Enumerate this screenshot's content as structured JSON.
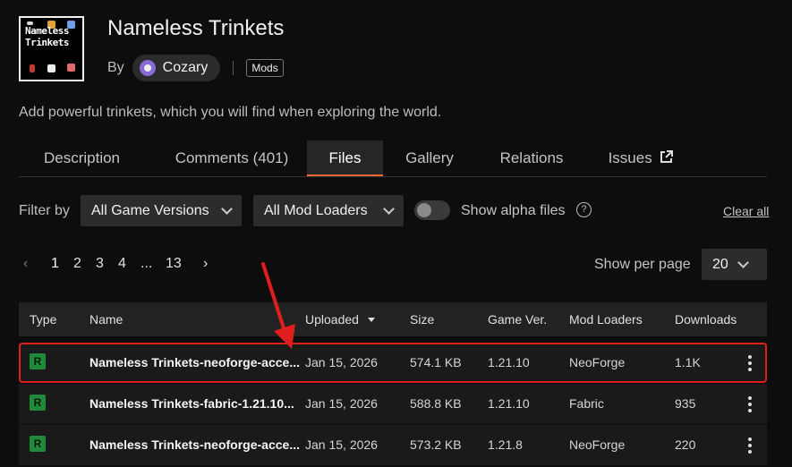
{
  "project": {
    "title": "Nameless Trinkets",
    "by_label": "By",
    "author": "Cozary",
    "category": "Mods",
    "summary": "Add powerful trinkets, which you will find when exploring the world.",
    "logo_text_line1": "Nameless",
    "logo_text_line2": "Trinkets"
  },
  "tabs": [
    {
      "label": "Description"
    },
    {
      "label": "Comments (401)"
    },
    {
      "label": "Files"
    },
    {
      "label": "Gallery"
    },
    {
      "label": "Relations"
    },
    {
      "label": "Issues"
    }
  ],
  "filters": {
    "label": "Filter by",
    "game_versions": "All Game Versions",
    "mod_loaders": "All Mod Loaders",
    "alpha_label": "Show alpha files",
    "help": "?",
    "clear": "Clear all"
  },
  "pagination": {
    "prev": "‹",
    "pages": [
      "1",
      "2",
      "3",
      "4"
    ],
    "ellipsis": "...",
    "last": "13",
    "next": "›",
    "per_page_label": "Show per page",
    "per_page_value": "20"
  },
  "table": {
    "headers": {
      "type": "Type",
      "name": "Name",
      "uploaded": "Uploaded",
      "size": "Size",
      "game_ver": "Game Ver.",
      "mod_loaders": "Mod Loaders",
      "downloads": "Downloads"
    },
    "rows": [
      {
        "type": "R",
        "name": "Nameless Trinkets-neoforge-acce...",
        "uploaded": "Jan 15, 2026",
        "size": "574.1 KB",
        "game_ver": "1.21.10",
        "loader": "NeoForge",
        "downloads": "1.1K"
      },
      {
        "type": "R",
        "name": "Nameless Trinkets-fabric-1.21.10...",
        "uploaded": "Jan 15, 2026",
        "size": "588.8 KB",
        "game_ver": "1.21.10",
        "loader": "Fabric",
        "downloads": "935"
      },
      {
        "type": "R",
        "name": "Nameless Trinkets-neoforge-acce...",
        "uploaded": "Jan 15, 2026",
        "size": "573.2 KB",
        "game_ver": "1.21.8",
        "loader": "NeoForge",
        "downloads": "220"
      }
    ]
  },
  "colors": {
    "accent": "#f16436",
    "highlight": "#e01e1e",
    "release_badge": "#1f8a3a"
  }
}
